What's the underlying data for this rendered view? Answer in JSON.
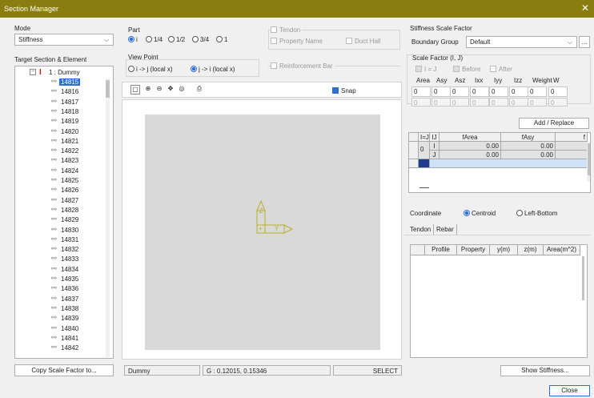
{
  "window": {
    "title": "Section Manager",
    "close_glyph": "✕"
  },
  "mode": {
    "label": "Mode",
    "value": "Stiffness"
  },
  "target": {
    "label": "Target Section & Element",
    "root": "1 : Dummy",
    "elements": [
      "14815",
      "14816",
      "14817",
      "14818",
      "14819",
      "14820",
      "14821",
      "14822",
      "14823",
      "14824",
      "14825",
      "14826",
      "14827",
      "14828",
      "14829",
      "14830",
      "14831",
      "14832",
      "14833",
      "14834",
      "14835",
      "14836",
      "14837",
      "14838",
      "14839",
      "14840",
      "14841",
      "14842"
    ],
    "selected": "14815",
    "copy_button": "Copy Scale Factor to..."
  },
  "part": {
    "label": "Part",
    "options": [
      "i",
      "1/4",
      "1/2",
      "3/4",
      "1"
    ],
    "selected": "i"
  },
  "viewpoint": {
    "label": "View Point",
    "options": [
      "i -> j (local x)",
      "j -> i (local x)"
    ],
    "selected": "j -> i (local x)"
  },
  "tendon_check": {
    "label": "Tendon",
    "property_name": "Property Name",
    "duct_hall": "Duct Hall"
  },
  "rebar_check": {
    "label": "Reinforcement Bar"
  },
  "toolbar": {
    "snap": "Snap"
  },
  "view": {
    "axis_z": "Z",
    "axis_y": "Y",
    "axis_plus": "+"
  },
  "status": {
    "name": "Dummy",
    "coord": "G : 0.12015, 0.15346",
    "mode": "SELECT"
  },
  "scale": {
    "title": "Stiffness Scale Factor",
    "boundary_label": "Boundary Group",
    "boundary_value": "Default",
    "more_btn": "...",
    "factor_label": "Scale Factor (I, J)",
    "opt_ij": "I = J",
    "opt_before": "Before",
    "opt_after": "After",
    "headers": [
      "Area",
      "Asy",
      "Asz",
      "Ixx",
      "Iyy",
      "Izz",
      "Weight",
      "W"
    ],
    "row1": [
      "0",
      "0",
      "0",
      "0",
      "0",
      "0",
      "0",
      "0"
    ],
    "row2": [
      "0",
      "0",
      "0",
      "0",
      "0",
      "0",
      "0",
      "0"
    ],
    "add_btn": "Add / Replace"
  },
  "grid": {
    "headers": [
      "I=J",
      "IJ",
      "fArea",
      "fAsy",
      "f"
    ],
    "group": "0",
    "rows": [
      {
        "ij": "I",
        "farea": "0.00",
        "fasy": "0.00"
      },
      {
        "ij": "J",
        "farea": "0.00",
        "fasy": "0.00"
      }
    ]
  },
  "coordinate": {
    "label": "Coordinate",
    "centroid": "Centroid",
    "leftbottom": "Left-Bottom"
  },
  "tabs": {
    "tendon": "Tendon",
    "rebar": "Rebar"
  },
  "tendon_table": {
    "headers": [
      "Profile",
      "Property",
      "y(m)",
      "z(m)",
      "Area(m^2)"
    ]
  },
  "buttons": {
    "show_stiffness": "Show Stiffness...",
    "close": "Close"
  }
}
